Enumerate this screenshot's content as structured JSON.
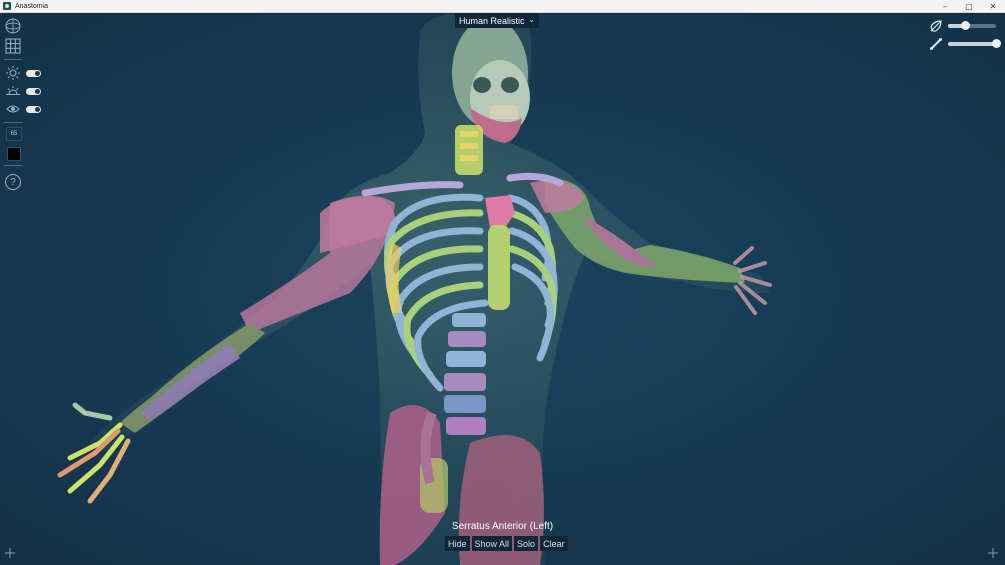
{
  "window": {
    "title": "Anastomia",
    "controls": {
      "minimize": "–",
      "maximize": "□",
      "close": "✕"
    }
  },
  "left_toolbar": {
    "items": [
      {
        "icon": "sphere-view-icon"
      },
      {
        "icon": "grid-icon"
      },
      {
        "icon": "light-icon",
        "toggle": true
      },
      {
        "icon": "sunset-icon",
        "toggle": true
      },
      {
        "icon": "xray-eye-icon",
        "toggle": true
      }
    ],
    "number_value": "65",
    "color_value": "#000000",
    "help_label": "?"
  },
  "preset": {
    "label": "Human Realistic"
  },
  "right_sliders": [
    {
      "icon": "skin-opacity-icon",
      "value": 0.35
    },
    {
      "icon": "bone-opacity-icon",
      "value": 1.0
    }
  ],
  "selection": {
    "label": "Serratus Anterior  (Left)",
    "actions": {
      "hide": "Hide",
      "show_all": "Show All",
      "solo": "Solo",
      "clear": "Clear"
    }
  },
  "colors": {
    "background": "#173a52",
    "toolbar_bg": "#0f2739",
    "muscle": "#c07aa0",
    "bone": "#a8c8a6",
    "rib": "#8fb4d6",
    "cartilage": "#cde36a"
  }
}
